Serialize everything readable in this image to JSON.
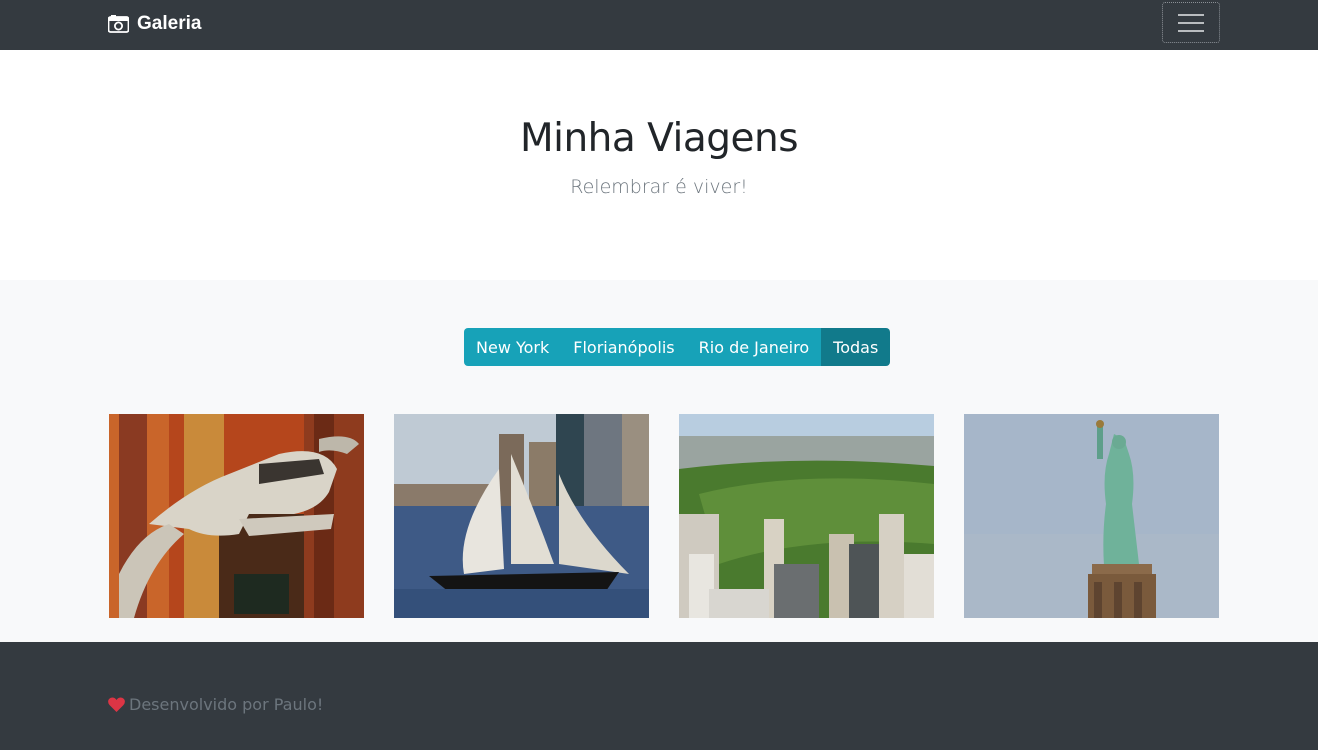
{
  "navbar": {
    "brand_icon": "camera-icon",
    "brand": "Galeria",
    "toggler_icon": "hamburger-menu-icon"
  },
  "hero": {
    "title": "Minha Viagens",
    "subtitle": "Relembrar é viver!"
  },
  "filters": [
    {
      "label": "New York",
      "active": false
    },
    {
      "label": "Florianópolis",
      "active": false
    },
    {
      "label": "Rio de Janeiro",
      "active": false
    },
    {
      "label": "Todas",
      "active": true
    }
  ],
  "photos": [
    {
      "subject": "dinosaur-skeleton-museum"
    },
    {
      "subject": "sailboat-harbor-skyline"
    },
    {
      "subject": "central-park-aerial"
    },
    {
      "subject": "statue-of-liberty"
    }
  ],
  "footer": {
    "icon": "heart-icon",
    "text": "Desenvolvido por Paulo!"
  },
  "colors": {
    "navbar_bg": "#343a40",
    "button_info": "#17a2b8",
    "button_active": "#117a8b",
    "heart": "#dc3545"
  }
}
